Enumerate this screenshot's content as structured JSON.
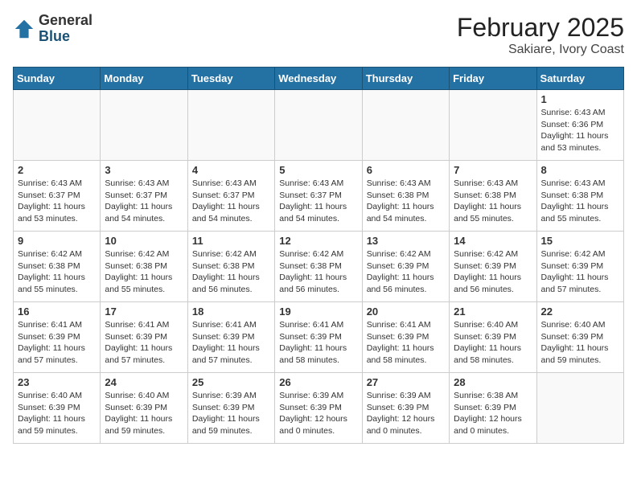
{
  "header": {
    "logo_general": "General",
    "logo_blue": "Blue",
    "month_year": "February 2025",
    "location": "Sakiare, Ivory Coast"
  },
  "weekdays": [
    "Sunday",
    "Monday",
    "Tuesday",
    "Wednesday",
    "Thursday",
    "Friday",
    "Saturday"
  ],
  "weeks": [
    [
      {
        "day": "",
        "info": ""
      },
      {
        "day": "",
        "info": ""
      },
      {
        "day": "",
        "info": ""
      },
      {
        "day": "",
        "info": ""
      },
      {
        "day": "",
        "info": ""
      },
      {
        "day": "",
        "info": ""
      },
      {
        "day": "1",
        "info": "Sunrise: 6:43 AM\nSunset: 6:36 PM\nDaylight: 11 hours and 53 minutes."
      }
    ],
    [
      {
        "day": "2",
        "info": "Sunrise: 6:43 AM\nSunset: 6:37 PM\nDaylight: 11 hours and 53 minutes."
      },
      {
        "day": "3",
        "info": "Sunrise: 6:43 AM\nSunset: 6:37 PM\nDaylight: 11 hours and 54 minutes."
      },
      {
        "day": "4",
        "info": "Sunrise: 6:43 AM\nSunset: 6:37 PM\nDaylight: 11 hours and 54 minutes."
      },
      {
        "day": "5",
        "info": "Sunrise: 6:43 AM\nSunset: 6:37 PM\nDaylight: 11 hours and 54 minutes."
      },
      {
        "day": "6",
        "info": "Sunrise: 6:43 AM\nSunset: 6:38 PM\nDaylight: 11 hours and 54 minutes."
      },
      {
        "day": "7",
        "info": "Sunrise: 6:43 AM\nSunset: 6:38 PM\nDaylight: 11 hours and 55 minutes."
      },
      {
        "day": "8",
        "info": "Sunrise: 6:43 AM\nSunset: 6:38 PM\nDaylight: 11 hours and 55 minutes."
      }
    ],
    [
      {
        "day": "9",
        "info": "Sunrise: 6:42 AM\nSunset: 6:38 PM\nDaylight: 11 hours and 55 minutes."
      },
      {
        "day": "10",
        "info": "Sunrise: 6:42 AM\nSunset: 6:38 PM\nDaylight: 11 hours and 55 minutes."
      },
      {
        "day": "11",
        "info": "Sunrise: 6:42 AM\nSunset: 6:38 PM\nDaylight: 11 hours and 56 minutes."
      },
      {
        "day": "12",
        "info": "Sunrise: 6:42 AM\nSunset: 6:38 PM\nDaylight: 11 hours and 56 minutes."
      },
      {
        "day": "13",
        "info": "Sunrise: 6:42 AM\nSunset: 6:39 PM\nDaylight: 11 hours and 56 minutes."
      },
      {
        "day": "14",
        "info": "Sunrise: 6:42 AM\nSunset: 6:39 PM\nDaylight: 11 hours and 56 minutes."
      },
      {
        "day": "15",
        "info": "Sunrise: 6:42 AM\nSunset: 6:39 PM\nDaylight: 11 hours and 57 minutes."
      }
    ],
    [
      {
        "day": "16",
        "info": "Sunrise: 6:41 AM\nSunset: 6:39 PM\nDaylight: 11 hours and 57 minutes."
      },
      {
        "day": "17",
        "info": "Sunrise: 6:41 AM\nSunset: 6:39 PM\nDaylight: 11 hours and 57 minutes."
      },
      {
        "day": "18",
        "info": "Sunrise: 6:41 AM\nSunset: 6:39 PM\nDaylight: 11 hours and 57 minutes."
      },
      {
        "day": "19",
        "info": "Sunrise: 6:41 AM\nSunset: 6:39 PM\nDaylight: 11 hours and 58 minutes."
      },
      {
        "day": "20",
        "info": "Sunrise: 6:41 AM\nSunset: 6:39 PM\nDaylight: 11 hours and 58 minutes."
      },
      {
        "day": "21",
        "info": "Sunrise: 6:40 AM\nSunset: 6:39 PM\nDaylight: 11 hours and 58 minutes."
      },
      {
        "day": "22",
        "info": "Sunrise: 6:40 AM\nSunset: 6:39 PM\nDaylight: 11 hours and 59 minutes."
      }
    ],
    [
      {
        "day": "23",
        "info": "Sunrise: 6:40 AM\nSunset: 6:39 PM\nDaylight: 11 hours and 59 minutes."
      },
      {
        "day": "24",
        "info": "Sunrise: 6:40 AM\nSunset: 6:39 PM\nDaylight: 11 hours and 59 minutes."
      },
      {
        "day": "25",
        "info": "Sunrise: 6:39 AM\nSunset: 6:39 PM\nDaylight: 11 hours and 59 minutes."
      },
      {
        "day": "26",
        "info": "Sunrise: 6:39 AM\nSunset: 6:39 PM\nDaylight: 12 hours and 0 minutes."
      },
      {
        "day": "27",
        "info": "Sunrise: 6:39 AM\nSunset: 6:39 PM\nDaylight: 12 hours and 0 minutes."
      },
      {
        "day": "28",
        "info": "Sunrise: 6:38 AM\nSunset: 6:39 PM\nDaylight: 12 hours and 0 minutes."
      },
      {
        "day": "",
        "info": ""
      }
    ]
  ]
}
